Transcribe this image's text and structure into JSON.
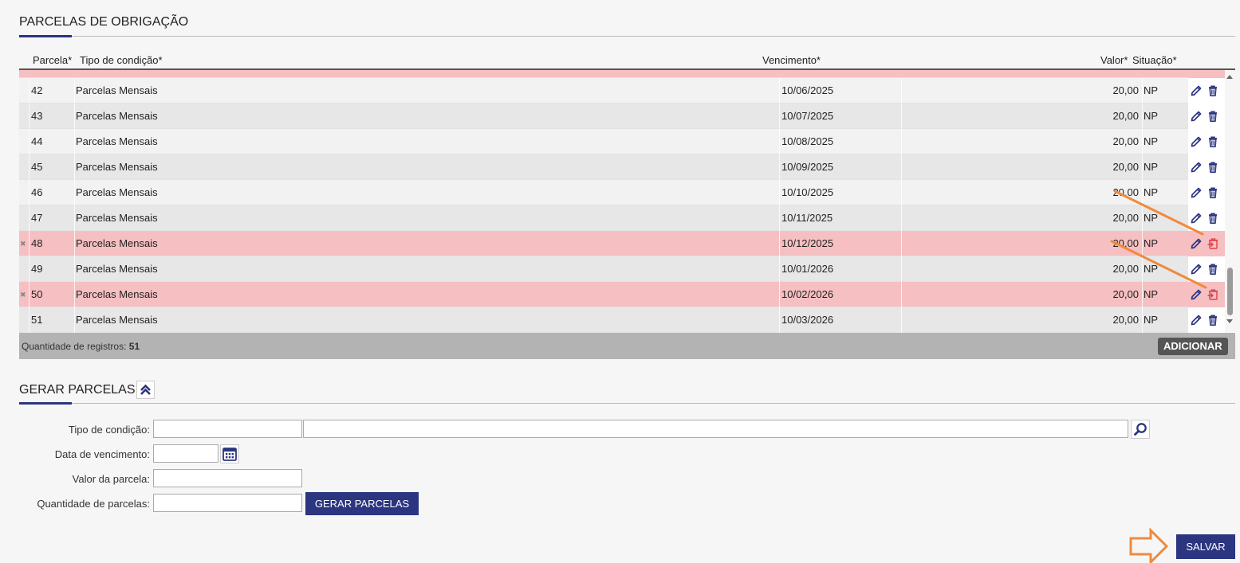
{
  "obligations": {
    "title": "PARCELAS DE OBRIGAÇÃO",
    "columns": {
      "parcela": "Parcela*",
      "tipo": "Tipo de condição*",
      "vencimento": "Vencimento*",
      "valor": "Valor*",
      "situacao": "Situação*"
    },
    "rows": [
      {
        "parcela": "42",
        "tipo": "Parcelas Mensais",
        "vencimento": "10/06/2025",
        "valor": "20,00",
        "situacao": "NP",
        "deleted": false
      },
      {
        "parcela": "43",
        "tipo": "Parcelas Mensais",
        "vencimento": "10/07/2025",
        "valor": "20,00",
        "situacao": "NP",
        "deleted": false
      },
      {
        "parcela": "44",
        "tipo": "Parcelas Mensais",
        "vencimento": "10/08/2025",
        "valor": "20,00",
        "situacao": "NP",
        "deleted": false
      },
      {
        "parcela": "45",
        "tipo": "Parcelas Mensais",
        "vencimento": "10/09/2025",
        "valor": "20,00",
        "situacao": "NP",
        "deleted": false
      },
      {
        "parcela": "46",
        "tipo": "Parcelas Mensais",
        "vencimento": "10/10/2025",
        "valor": "20,00",
        "situacao": "NP",
        "deleted": false
      },
      {
        "parcela": "47",
        "tipo": "Parcelas Mensais",
        "vencimento": "10/11/2025",
        "valor": "20,00",
        "situacao": "NP",
        "deleted": false
      },
      {
        "parcela": "48",
        "tipo": "Parcelas Mensais",
        "vencimento": "10/12/2025",
        "valor": "20,00",
        "situacao": "NP",
        "deleted": true
      },
      {
        "parcela": "49",
        "tipo": "Parcelas Mensais",
        "vencimento": "10/01/2026",
        "valor": "20,00",
        "situacao": "NP",
        "deleted": false
      },
      {
        "parcela": "50",
        "tipo": "Parcelas Mensais",
        "vencimento": "10/02/2026",
        "valor": "20,00",
        "situacao": "NP",
        "deleted": true
      },
      {
        "parcela": "51",
        "tipo": "Parcelas Mensais",
        "vencimento": "10/03/2026",
        "valor": "20,00",
        "situacao": "NP",
        "deleted": false
      }
    ],
    "deleted_marker": "✖",
    "footer": {
      "count_label": "Quantidade de registros:",
      "count_value": "51",
      "add_button": "ADICIONAR"
    }
  },
  "generate": {
    "title": "GERAR PARCELAS",
    "fields": {
      "tipo_label": "Tipo de condição:",
      "tipo_code": "",
      "tipo_desc": "",
      "data_label": "Data de vencimento:",
      "data_value": "",
      "valor_label": "Valor da parcela:",
      "valor_value": "",
      "quantidade_label": "Quantidade de parcelas:",
      "quantidade_value": ""
    },
    "generate_button": "GERAR PARCELAS"
  },
  "save_button": "SALVAR",
  "colors": {
    "primary": "#2c3580",
    "deleted_row": "#f6bfc1",
    "annotation": "#f08a3c",
    "delete_icon_active": "#2c3580",
    "delete_icon_deleted": "#e0404a"
  },
  "icons": [
    "edit-icon",
    "trash-icon",
    "restore-icon",
    "chevron-up-double-icon",
    "search-icon",
    "calendar-icon",
    "scroll-up-icon",
    "scroll-down-icon",
    "arrow-right-annotation"
  ]
}
